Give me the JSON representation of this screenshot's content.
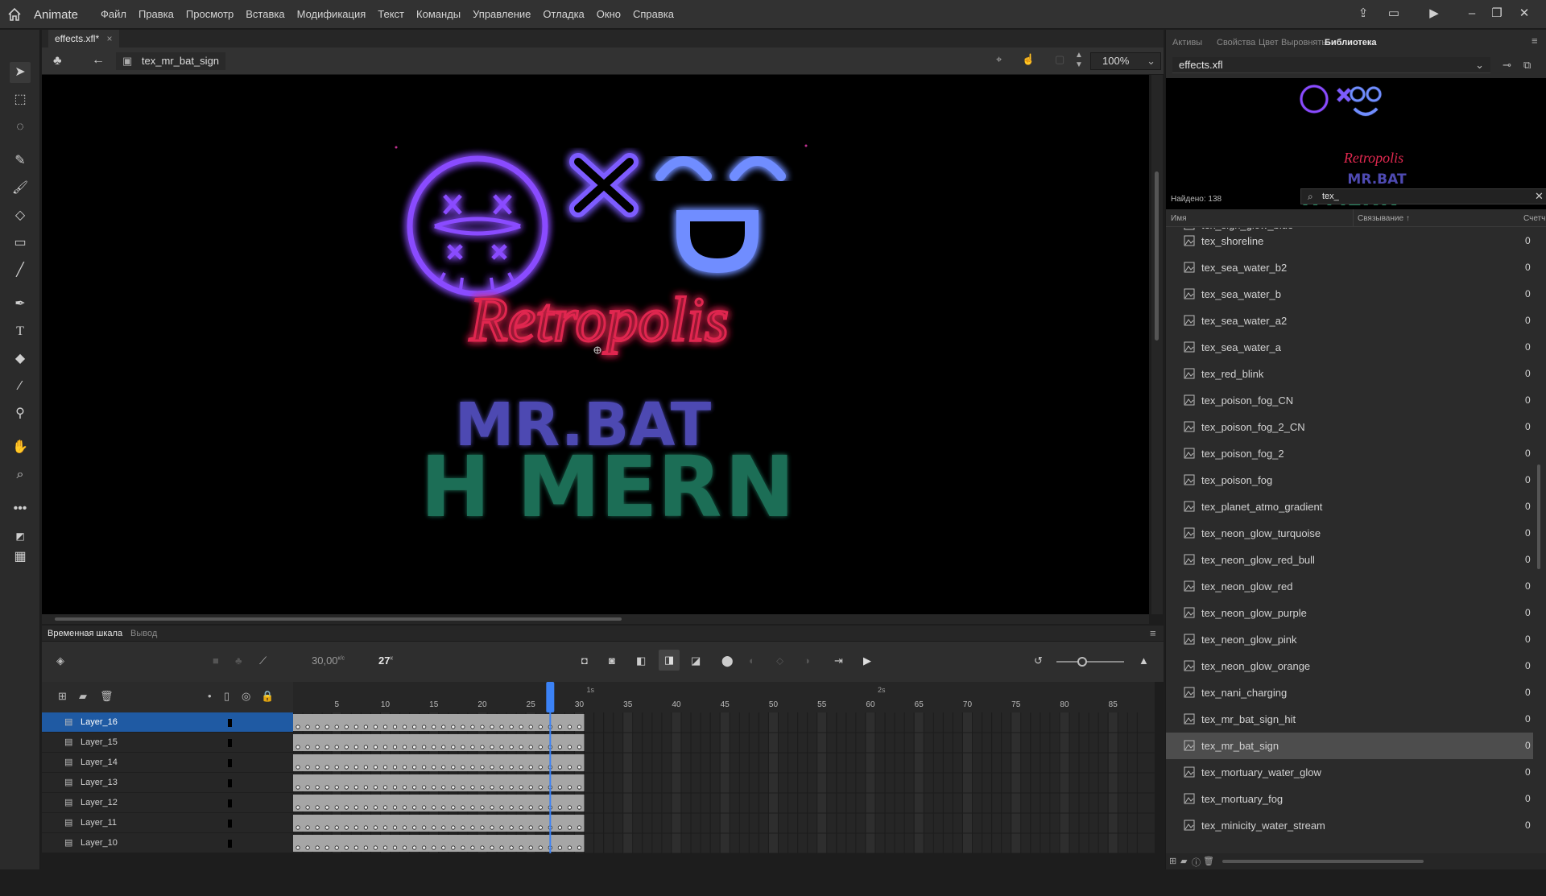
{
  "app": {
    "name": "Animate"
  },
  "menu": [
    "Файл",
    "Правка",
    "Просмотр",
    "Вставка",
    "Модификация",
    "Текст",
    "Команды",
    "Управление",
    "Отладка",
    "Окно",
    "Справка"
  ],
  "document": {
    "tab_label": "effects.xfl*",
    "symbol_name": "tex_mr_bat_sign",
    "zoom": "100%"
  },
  "stage_art": {
    "logo_text": "Retropolis",
    "title_text": "MR.BAT",
    "h": "H",
    "mer": "MER",
    "n": "N"
  },
  "timeline": {
    "tabs": [
      "Временная шкала",
      "Вывод"
    ],
    "fps": "30,00",
    "fps_unit": "к/с",
    "current_frame": "27",
    "frame_unit": "к",
    "ruler_ticks": [
      "5",
      "10",
      "15",
      "20",
      "25",
      "30",
      "35",
      "40",
      "45",
      "50",
      "55",
      "60",
      "65",
      "70",
      "75",
      "80",
      "85"
    ],
    "second_marks": [
      "1s",
      "2s"
    ],
    "layers": [
      "Layer_16",
      "Layer_15",
      "Layer_14",
      "Layer_13",
      "Layer_12",
      "Layer_11",
      "Layer_10"
    ],
    "total_frames": 30,
    "playhead_frame": 27
  },
  "panel": {
    "tabs": [
      "Активы",
      "Свойства",
      "Цвет",
      "Выровнять",
      "Библиотека"
    ],
    "library_file": "effects.xfl",
    "found": "Найдено: 138",
    "search_value": "tex_",
    "col_name": "Имя",
    "col_link": "Связывание",
    "col_count": "Счетч",
    "partial_item": "tex_sign_glow_blue",
    "items": [
      {
        "name": "tex_shoreline",
        "count": "0"
      },
      {
        "name": "tex_sea_water_b2",
        "count": "0"
      },
      {
        "name": "tex_sea_water_b",
        "count": "0"
      },
      {
        "name": "tex_sea_water_a2",
        "count": "0"
      },
      {
        "name": "tex_sea_water_a",
        "count": "0"
      },
      {
        "name": "tex_red_blink",
        "count": "0"
      },
      {
        "name": "tex_poison_fog_CN",
        "count": "0"
      },
      {
        "name": "tex_poison_fog_2_CN",
        "count": "0"
      },
      {
        "name": "tex_poison_fog_2",
        "count": "0"
      },
      {
        "name": "tex_poison_fog",
        "count": "0"
      },
      {
        "name": "tex_planet_atmo_gradient",
        "count": "0"
      },
      {
        "name": "tex_neon_glow_turquoise",
        "count": "0"
      },
      {
        "name": "tex_neon_glow_red_bull",
        "count": "0"
      },
      {
        "name": "tex_neon_glow_red",
        "count": "0"
      },
      {
        "name": "tex_neon_glow_purple",
        "count": "0"
      },
      {
        "name": "tex_neon_glow_pink",
        "count": "0"
      },
      {
        "name": "tex_neon_glow_orange",
        "count": "0"
      },
      {
        "name": "tex_nani_charging",
        "count": "0"
      },
      {
        "name": "tex_mr_bat_sign_hit",
        "count": "0"
      },
      {
        "name": "tex_mr_bat_sign",
        "count": "0"
      },
      {
        "name": "tex_mortuary_water_glow",
        "count": "0"
      },
      {
        "name": "tex_mortuary_fog",
        "count": "0"
      },
      {
        "name": "tex_minicity_water_stream",
        "count": "0"
      }
    ],
    "selected_item": "tex_mr_bat_sign"
  },
  "colors": {
    "neon_purple": "#8a4cff",
    "neon_blue": "#6f8dff",
    "neon_red": "#e0284f",
    "neon_green": "#1f6e57",
    "mrbat": "#4e4ab2",
    "accent": "#1f5aa3"
  }
}
